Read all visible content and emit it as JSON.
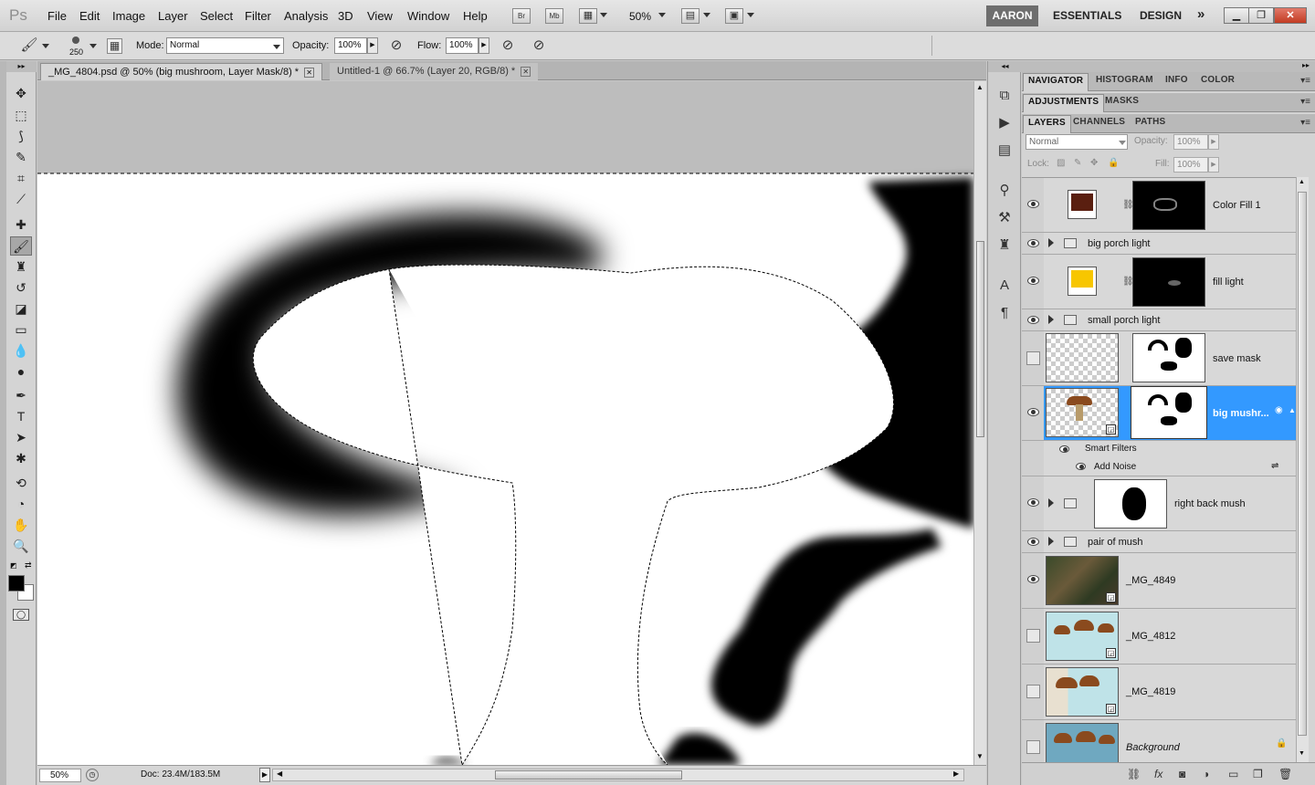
{
  "app": {
    "logo": "Ps"
  },
  "menu": [
    "File",
    "Edit",
    "Image",
    "Layer",
    "Select",
    "Filter",
    "Analysis",
    "3D",
    "View",
    "Window",
    "Help"
  ],
  "appbar": {
    "br": "Br",
    "mb": "Mb",
    "zoom": "50%"
  },
  "workspaces": {
    "active": "AARON",
    "items": [
      "ESSENTIALS",
      "DESIGN"
    ],
    "more": "»"
  },
  "options": {
    "brush_size": "250",
    "mode_label": "Mode:",
    "mode_value": "Normal",
    "opacity_label": "Opacity:",
    "opacity_value": "100%",
    "flow_label": "Flow:",
    "flow_value": "100%"
  },
  "doc_tabs": [
    {
      "label": "_MG_4804.psd @ 50% (big mushroom, Layer Mask/8) *",
      "close": "✕"
    },
    {
      "label": "Untitled-1 @ 66.7% (Layer 20, RGB/8) *",
      "close": "✕"
    }
  ],
  "status": {
    "zoom": "50%",
    "doc": "Doc: 23.4M/183.5M"
  },
  "panels": {
    "row1": [
      "NAVIGATOR",
      "HISTOGRAM",
      "INFO",
      "COLOR"
    ],
    "row2": [
      "ADJUSTMENTS",
      "MASKS"
    ],
    "row3": [
      "LAYERS",
      "CHANNELS",
      "PATHS"
    ],
    "blend_mode": "Normal",
    "opacity_label": "Opacity:",
    "opacity_value": "100%",
    "lock_label": "Lock:",
    "fill_label": "Fill:",
    "fill_value": "100%"
  },
  "layers": [
    {
      "name": "Color Fill 1",
      "type": "fill",
      "color": "#5a1f10",
      "visible": true
    },
    {
      "name": "big porch light",
      "type": "group",
      "visible": true
    },
    {
      "name": "fill light",
      "type": "fill",
      "color": "#f7c600",
      "visible": true
    },
    {
      "name": "small porch light",
      "type": "group",
      "visible": true
    },
    {
      "name": "save mask",
      "type": "masked",
      "visible": false
    },
    {
      "name": "big mushr...",
      "type": "smart",
      "visible": true,
      "selected": true
    },
    {
      "name": "Smart Filters",
      "type": "sub"
    },
    {
      "name": "Add Noise",
      "type": "sub"
    },
    {
      "name": "right back mush",
      "type": "group-mask",
      "visible": true
    },
    {
      "name": "pair of mush",
      "type": "group",
      "visible": true
    },
    {
      "name": "_MG_4849",
      "type": "image",
      "visible": true
    },
    {
      "name": "_MG_4812",
      "type": "image",
      "visible": false
    },
    {
      "name": "_MG_4819",
      "type": "image",
      "visible": false
    },
    {
      "name": "Background",
      "type": "image",
      "visible": false
    }
  ],
  "colors": {
    "selection": "#3399ff",
    "foreground": "#000000",
    "background": "#ffffff"
  }
}
